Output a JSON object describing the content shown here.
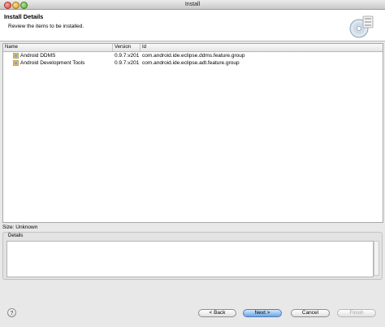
{
  "window": {
    "title": "Install"
  },
  "header": {
    "title": "Install Details",
    "description": "Review the items to be installed."
  },
  "table": {
    "columns": [
      "Name",
      "Version",
      "Id"
    ],
    "rows": [
      {
        "name": "Android DDMS",
        "version": "0.9.7.v201",
        "id": "com.android.ide.eclipse.ddms.feature.group"
      },
      {
        "name": "Android Development Tools",
        "version": "0.9.7.v201",
        "id": "com.android.ide.eclipse.adt.feature.group"
      }
    ]
  },
  "size_label": "Size: Unknown",
  "details": {
    "legend": "Details",
    "text": ""
  },
  "buttons": {
    "help": "?",
    "back": "< Back",
    "next": "Next >",
    "cancel": "Cancel",
    "finish": "Finish"
  },
  "icons": {
    "header": "install-cd-icon",
    "row": "feature-package-icon"
  },
  "colors": {
    "primary_button": "#6aa5e6",
    "window_bg": "#e8e8e8"
  }
}
